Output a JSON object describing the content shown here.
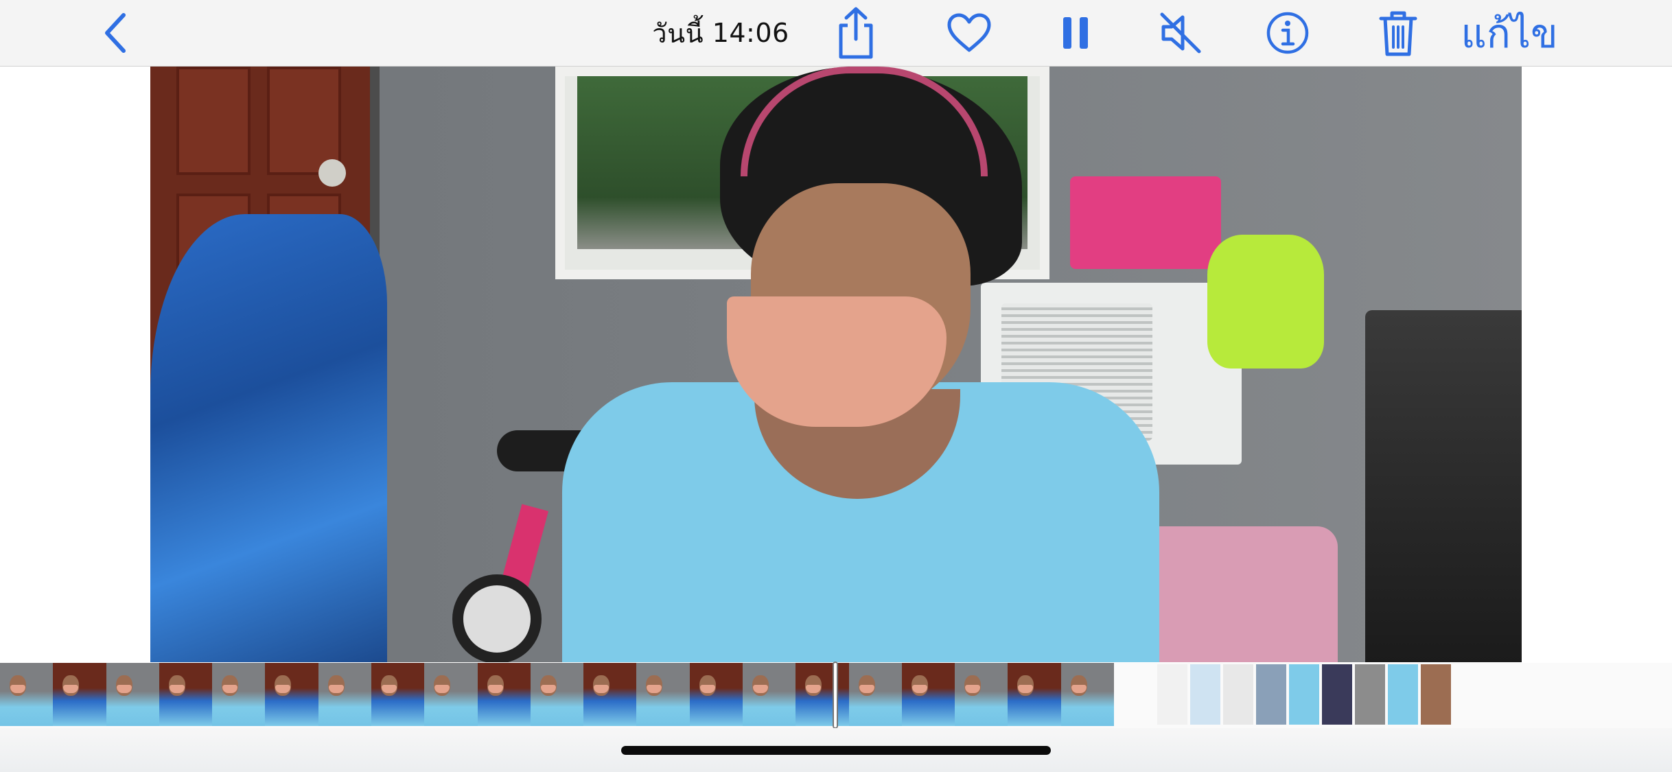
{
  "app": "Photos",
  "toolbar": {
    "back_icon": "chevron-left-icon",
    "date_label": "วันนี้",
    "time": "14:06",
    "share_icon": "share-icon",
    "favorite_icon": "heart-icon",
    "pause_icon": "pause-icon",
    "mute_icon": "speaker-muted-icon",
    "info_icon": "info-icon",
    "delete_icon": "trash-icon",
    "edit_label": "แก้ไข",
    "accent_color": "#2f6fe3"
  },
  "media": {
    "type": "video",
    "state": "paused-control-visible",
    "muted": true
  },
  "filmstrip": {
    "frame_count": 21,
    "other_thumbnails": 9
  }
}
